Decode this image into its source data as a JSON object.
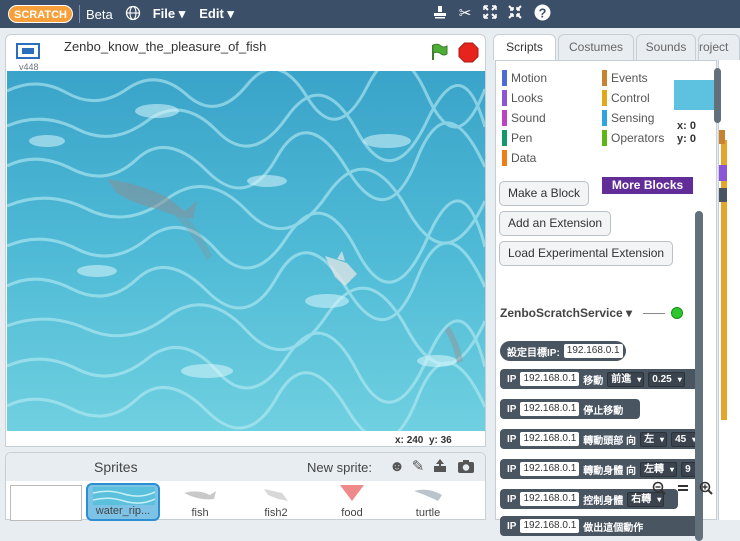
{
  "menubar": {
    "logo": "SCRATCH",
    "beta": "Beta",
    "file": "File ▾",
    "edit": "Edit ▾"
  },
  "stage": {
    "version": "v448",
    "project_title": "Zenbo_know_the_pleasure_of_fish",
    "x_label": "x:",
    "x_value": "240",
    "y_label": "y:",
    "y_value": "36"
  },
  "sprites": {
    "title": "Sprites",
    "new_sprite": "New sprite:",
    "items": [
      {
        "name": "water_rip..."
      },
      {
        "name": "fish"
      },
      {
        "name": "fish2"
      },
      {
        "name": "food"
      },
      {
        "name": "turtle"
      }
    ]
  },
  "tabs": {
    "scripts": "Scripts",
    "costumes": "Costumes",
    "sounds": "Sounds",
    "project": "roject"
  },
  "categories": [
    {
      "label": "Motion",
      "color": "#4a6cd4"
    },
    {
      "label": "Looks",
      "color": "#8a55d7"
    },
    {
      "label": "Sound",
      "color": "#bb42c3"
    },
    {
      "label": "Pen",
      "color": "#0e9a6c"
    },
    {
      "label": "Data",
      "color": "#ee7d16"
    },
    {
      "label": "Events",
      "color": "#c88330"
    },
    {
      "label": "Control",
      "color": "#e1a91a"
    },
    {
      "label": "Sensing",
      "color": "#2ca5e2"
    },
    {
      "label": "Operators",
      "color": "#5cb712"
    },
    {
      "label": "More Blocks",
      "color": "#632d99"
    }
  ],
  "palette": {
    "make_block": "Make a Block",
    "add_extension": "Add an Extension",
    "load_experimental": "Load Experimental Extension",
    "extension_name": "ZenboScratchService",
    "ip_default": "192.168.0.1"
  },
  "blocks": {
    "set_ip": "設定目標IP:",
    "ip": "IP",
    "move": "移動",
    "move_dir": "前進",
    "move_speed": "0.25",
    "stop_move": "停止移動",
    "turn_head": "轉動頭部 向",
    "turn_head_dir": "左",
    "turn_head_deg": "45",
    "turn_body": "轉動身體 向",
    "turn_body_dir": "左轉",
    "turn_body_deg": "9",
    "control_body": "控制身體",
    "control_body_dir": "右轉",
    "expression": "做出這個動作"
  },
  "sprite_info": {
    "x": "x: 0",
    "y": "y: 0"
  }
}
